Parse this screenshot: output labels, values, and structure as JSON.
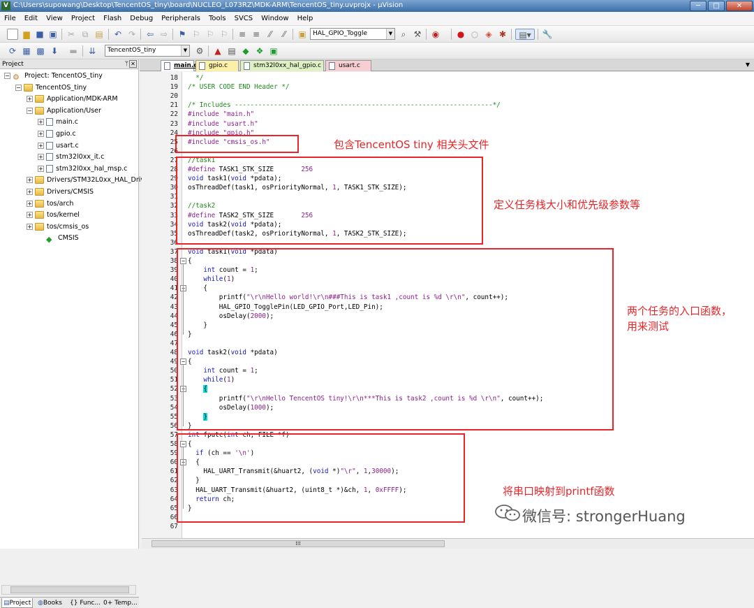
{
  "window": {
    "app_icon": "V",
    "title": "C:\\Users\\supowang\\Desktop\\TencentOS_tiny\\board\\NUCLEO_L073RZ\\MDK-ARM\\TencentOS_tiny.uvprojx - μVision",
    "minimize": "─",
    "maximize": "□",
    "close": "✕"
  },
  "menu": [
    "File",
    "Edit",
    "View",
    "Project",
    "Flash",
    "Debug",
    "Peripherals",
    "Tools",
    "SVCS",
    "Window",
    "Help"
  ],
  "toolbar": {
    "function_combo": "HAL_GPIO_Toggle",
    "target_combo": "TencentOS_tiny"
  },
  "project_panel": {
    "title": "Project",
    "pin": "ᛘ",
    "close": "✕",
    "tree": [
      {
        "label": "Project: TencentOS_tiny",
        "icon": "gear",
        "exp": "−"
      },
      {
        "label": "TencentOS_tiny",
        "icon": "folder",
        "exp": "−"
      },
      {
        "label": "Application/MDK-ARM",
        "icon": "folder",
        "exp": "+"
      },
      {
        "label": "Application/User",
        "icon": "folder",
        "exp": "−"
      },
      {
        "label": "main.c",
        "icon": "file",
        "exp": "+"
      },
      {
        "label": "gpio.c",
        "icon": "file",
        "exp": "+"
      },
      {
        "label": "usart.c",
        "icon": "file",
        "exp": "+"
      },
      {
        "label": "stm32l0xx_it.c",
        "icon": "file",
        "exp": "+"
      },
      {
        "label": "stm32l0xx_hal_msp.c",
        "icon": "file",
        "exp": "+"
      },
      {
        "label": "Drivers/STM32L0xx_HAL_Driv",
        "icon": "folder",
        "exp": "+"
      },
      {
        "label": "Drivers/CMSIS",
        "icon": "folder",
        "exp": "+"
      },
      {
        "label": "tos/arch",
        "icon": "folder",
        "exp": "+"
      },
      {
        "label": "tos/kernel",
        "icon": "folder",
        "exp": "+"
      },
      {
        "label": "tos/cmsis_os",
        "icon": "folder",
        "exp": "+"
      },
      {
        "label": "CMSIS",
        "icon": "diamond",
        "exp": ""
      }
    ],
    "bottom_tabs": [
      "Project",
      "Books",
      "{} Func...",
      "0+ Temp..."
    ]
  },
  "editor_tabs": [
    {
      "label": "main.c",
      "style": "main"
    },
    {
      "label": "gpio.c",
      "style": "gpio"
    },
    {
      "label": "stm32l0xx_hal_gpio.c",
      "style": "hal"
    },
    {
      "label": "usart.c",
      "style": "usart"
    }
  ],
  "code_lines": [
    {
      "n": "18",
      "html": "<span class='c'>  */</span>"
    },
    {
      "n": "19",
      "html": "<span class='c'>/* USER CODE END Header */</span>"
    },
    {
      "n": "20",
      "html": ""
    },
    {
      "n": "21",
      "html": "<span class='c'>/* Includes ------------------------------------------------------------------*/</span>"
    },
    {
      "n": "22",
      "html": "<span class='pp'>#include \"main.h\"</span>"
    },
    {
      "n": "23",
      "html": "<span class='pp'>#include \"usart.h\"</span>"
    },
    {
      "n": "24",
      "html": "<span class='pp'>#include \"gpio.h\"</span>"
    },
    {
      "n": "25",
      "html": "<span class='pp'>#include \"cmsis_os.h\"</span>"
    },
    {
      "n": "26",
      "html": ""
    },
    {
      "n": "27",
      "html": "<span class='c'>//task1</span>"
    },
    {
      "n": "28",
      "html": "<span class='pp'>#define</span> TASK1_STK_SIZE       <span class='n'>256</span>"
    },
    {
      "n": "29",
      "html": "<span class='k'>void</span> task1(<span class='k'>void</span> *pdata);"
    },
    {
      "n": "30",
      "html": "osThreadDef(task1, osPriorityNormal, <span class='n'>1</span>, TASK1_STK_SIZE);"
    },
    {
      "n": "31",
      "html": ""
    },
    {
      "n": "32",
      "html": "<span class='c'>//task2</span>"
    },
    {
      "n": "33",
      "html": "<span class='pp'>#define</span> TASK2_STK_SIZE       <span class='n'>256</span>"
    },
    {
      "n": "34",
      "html": "<span class='k'>void</span> task2(<span class='k'>void</span> *pdata);"
    },
    {
      "n": "35",
      "html": "osThreadDef(task2, osPriorityNormal, <span class='n'>1</span>, TASK2_STK_SIZE);"
    },
    {
      "n": "36",
      "html": ""
    },
    {
      "n": "37",
      "html": "<span class='k'>void</span> task1(<span class='k'>void</span> *pdata)"
    },
    {
      "n": "38",
      "html": "{"
    },
    {
      "n": "39",
      "html": "    <span class='k'>int</span> count = <span class='n'>1</span>;"
    },
    {
      "n": "40",
      "html": "    <span class='k'>while</span>(<span class='n'>1</span>)"
    },
    {
      "n": "41",
      "html": "    {"
    },
    {
      "n": "42",
      "html": "        printf(<span class='s'>\"\\r\\nHello world!\\r\\n###This is task1 ,count is %d \\r\\n\"</span>, count++);"
    },
    {
      "n": "43",
      "html": "        HAL_GPIO_TogglePin(LED_GPIO_Port,LED_Pin);"
    },
    {
      "n": "44",
      "html": "        osDelay(<span class='n'>2000</span>);"
    },
    {
      "n": "45",
      "html": "    }"
    },
    {
      "n": "46",
      "html": "}"
    },
    {
      "n": "47",
      "html": ""
    },
    {
      "n": "48",
      "html": "<span class='k'>void</span> task2(<span class='k'>void</span> *pdata)"
    },
    {
      "n": "49",
      "html": "{"
    },
    {
      "n": "50",
      "html": "    <span class='k'>int</span> count = <span class='n'>1</span>;"
    },
    {
      "n": "51",
      "html": "    <span class='k'>while</span>(<span class='n'>1</span>)"
    },
    {
      "n": "52",
      "html": "    <span class='hl'>{</span>"
    },
    {
      "n": "53",
      "html": "        printf(<span class='s'>\"\\r\\nHello TencentOS tiny!\\r\\n***This is task2 ,count is %d \\r\\n\"</span>, count++);"
    },
    {
      "n": "54",
      "html": "        osDelay(<span class='n'>1000</span>);"
    },
    {
      "n": "55",
      "html": "    <span class='hl'>}</span>"
    },
    {
      "n": "56",
      "html": "}"
    },
    {
      "n": "57",
      "html": "<span class='k'>int</span> fputc(<span class='k'>int</span> ch, FILE *f)"
    },
    {
      "n": "58",
      "html": "{"
    },
    {
      "n": "59",
      "html": "  <span class='k'>if</span> (ch == <span class='s'>'\\n'</span>)"
    },
    {
      "n": "60",
      "html": "  {"
    },
    {
      "n": "61",
      "html": "    HAL_UART_Transmit(&amp;huart2, (<span class='k'>void</span> *)<span class='s'>\"\\r\"</span>, <span class='n'>1</span>,<span class='n'>30000</span>);"
    },
    {
      "n": "62",
      "html": "  }"
    },
    {
      "n": "63",
      "html": "  HAL_UART_Transmit(&amp;huart2, (uint8_t *)&amp;ch, <span class='n'>1</span>, <span class='n'>0xFFFF</span>);"
    },
    {
      "n": "64",
      "html": "  <span class='k'>return</span> ch;"
    },
    {
      "n": "65",
      "html": "}"
    },
    {
      "n": "66",
      "html": ""
    },
    {
      "n": "67",
      "html": ""
    }
  ],
  "annotations": {
    "include_note": "包含TencentOS tiny 相关头文件",
    "define_note": "定义任务栈大小和优先级参数等",
    "entry_note_line1": "两个任务的入口函数，",
    "entry_note_line2": "用来测试",
    "printf_note": "将串口映射到printf函数"
  },
  "watermark": {
    "icon": "wechat-icon",
    "text": "微信号: strongerHuang"
  },
  "colors": {
    "annotation": "#e8262a",
    "keyword": "#1515c0",
    "comment": "#1e8a1e",
    "string": "#8b1f8b",
    "brace_highlight": "#00e0e0"
  }
}
